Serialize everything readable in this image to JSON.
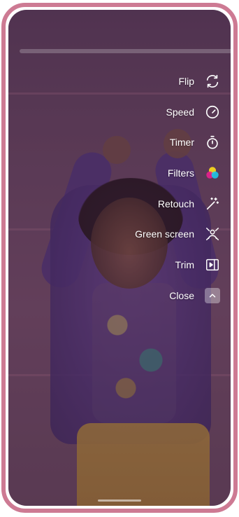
{
  "menu": {
    "items": [
      {
        "key": "flip",
        "label": "Flip",
        "icon": "flip-camera-icon"
      },
      {
        "key": "speed",
        "label": "Speed",
        "icon": "speedometer-icon"
      },
      {
        "key": "timer",
        "label": "Timer",
        "icon": "stopwatch-icon"
      },
      {
        "key": "filters",
        "label": "Filters",
        "icon": "color-circles-icon"
      },
      {
        "key": "retouch",
        "label": "Retouch",
        "icon": "magic-wand-icon"
      },
      {
        "key": "green_screen",
        "label": "Green screen",
        "icon": "green-screen-icon"
      },
      {
        "key": "trim",
        "label": "Trim",
        "icon": "trim-icon"
      },
      {
        "key": "close",
        "label": "Close",
        "icon": "chevron-up-icon"
      }
    ]
  },
  "colors": {
    "frame": "#cd7a93",
    "text": "#ffffff",
    "filters_cyan": "#1ec8e8",
    "filters_magenta": "#e8208f",
    "filters_yellow": "#f6d51e"
  }
}
